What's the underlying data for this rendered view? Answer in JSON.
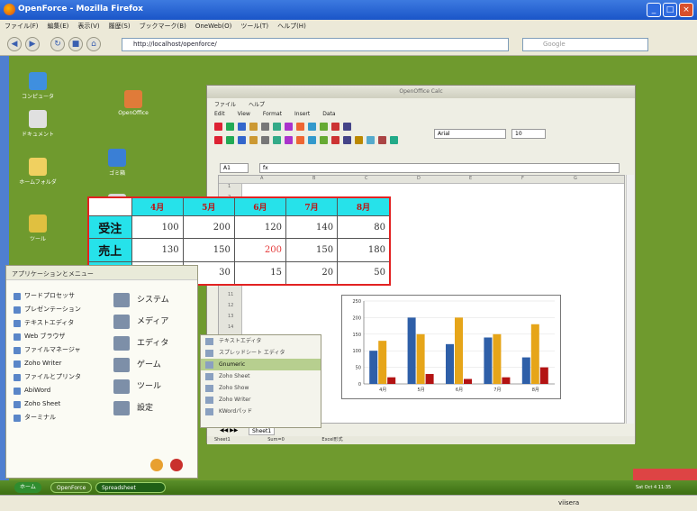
{
  "browser": {
    "title": "OpenForce - Mozilla Firefox",
    "menu": [
      "ファイル(F)",
      "編集(E)",
      "表示(V)",
      "履歴(S)",
      "ブックマーク(B)",
      "OneWeb(O)",
      "ツール(T)",
      "ヘルプ(H)"
    ],
    "url": "http://localhost/openforce/",
    "search_placeholder": "Google",
    "status_right": "viisera"
  },
  "desktop_icons": [
    {
      "label": "コンピュータ",
      "color": "#3f8fdf"
    },
    {
      "label": "OpenOffice",
      "color": "#e07b39"
    },
    {
      "label": "ドキュメント",
      "color": "#e0e0e0"
    },
    {
      "label": "ゴミ箱",
      "color": "#3a7fd5"
    },
    {
      "label": "ホームフォルダ",
      "color": "#f0d060"
    },
    {
      "label": "ネットワーク",
      "color": "#d9d9d9"
    },
    {
      "label": "ツール",
      "color": "#e0c040"
    }
  ],
  "start_menu": {
    "header": "アプリケーションとメニュー",
    "left_items": [
      "ワードプロセッサ",
      "プレゼンテーション",
      "テキストエディタ",
      "Web ブラウザ",
      "ファイルマネージャ",
      "Zoho Writer",
      "ファイルとプリンタ",
      "AbiWord",
      "Zoho Sheet",
      "ターミナル"
    ],
    "right_items": [
      "システム",
      "メディア",
      "エディタ",
      "ゲーム",
      "ツール",
      "設定"
    ]
  },
  "submenu": {
    "items": [
      "テキストエディタ",
      "スプレッドシート エディタ",
      "Gnumeric",
      "Zoho Sheet",
      "Zoho Show",
      "Zoho Writer",
      "KWordパッド"
    ],
    "selected_index": 2
  },
  "calc": {
    "title": "OpenOffice Calc",
    "window_menu": [
      "ファイル",
      "ヘルプ"
    ],
    "menu": [
      "Edit",
      "View",
      "Format",
      "Insert",
      "Data"
    ],
    "font": "Arial",
    "font_size": "10",
    "cell_ref": "A1",
    "formula_label": "fx",
    "columns": [
      "A",
      "B",
      "C",
      "D",
      "E",
      "F",
      "G",
      "H"
    ],
    "rows": [
      "1",
      "2",
      "3",
      "4",
      "5",
      "6",
      "7",
      "8",
      "9",
      "10",
      "11",
      "12",
      "13",
      "14",
      "15",
      "16",
      "17",
      "18",
      "19",
      "20",
      "21",
      "22"
    ],
    "sheet_tab": "Sheet1",
    "status_items": [
      "Sheet1",
      "Sum=0",
      "Excel形式"
    ]
  },
  "table": {
    "headers": [
      "4月",
      "5月",
      "6月",
      "7月",
      "8月"
    ],
    "rows": [
      {
        "label": "受注",
        "values": [
          "100",
          "200",
          "120",
          "140",
          "80"
        ]
      },
      {
        "label": "売上",
        "values": [
          "130",
          "150",
          "200",
          "150",
          "180"
        ]
      },
      {
        "label": "粗利",
        "values": [
          "20",
          "30",
          "15",
          "20",
          "50"
        ]
      }
    ],
    "highlight_color": "#26e2ea",
    "border_color": "#e22222"
  },
  "chart_data": {
    "type": "bar",
    "categories": [
      "4月",
      "5月",
      "6月",
      "7月",
      "8月"
    ],
    "series": [
      {
        "name": "",
        "values": [
          100,
          200,
          120,
          140,
          80
        ],
        "color": "#2e5fa8"
      },
      {
        "name": "",
        "values": [
          130,
          150,
          200,
          150,
          180
        ],
        "color": "#e6a519"
      },
      {
        "name": "",
        "values": [
          20,
          30,
          15,
          20,
          50
        ],
        "color": "#b31313"
      }
    ],
    "ylim": [
      0,
      250
    ],
    "yticks": [
      "0",
      "50",
      "100",
      "150",
      "200",
      "250"
    ],
    "title": "",
    "xlabel": "",
    "ylabel": ""
  },
  "taskbar": {
    "items": [
      "ホーム",
      "OpenForce",
      "Spreadsheet"
    ],
    "tray": "Sat Oct 4 11:35"
  }
}
